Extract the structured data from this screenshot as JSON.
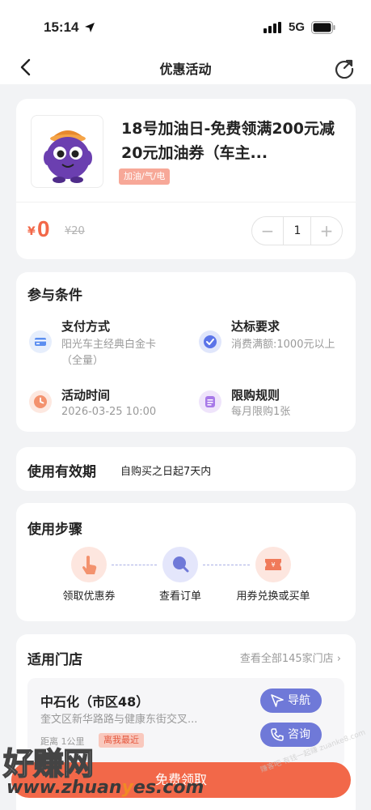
{
  "status_bar": {
    "time": "15:14",
    "network": "5G"
  },
  "nav": {
    "title": "优惠活动"
  },
  "product": {
    "title": "18号加油日-免费领满200元减20元加油券（车主...",
    "tag": "加油/气/电",
    "currency": "¥",
    "price": "0",
    "original_price": "¥20",
    "quantity": "1",
    "minus": "−",
    "plus": "+"
  },
  "conditions": {
    "title": "参与条件",
    "payment": {
      "label": "支付方式",
      "value": "阳光车主经典白金卡（全量）"
    },
    "standard": {
      "label": "达标要求",
      "value": "消费满额:1000元以上"
    },
    "time": {
      "label": "活动时间",
      "value": "2026-03-25 10:00"
    },
    "limit": {
      "label": "限购规则",
      "value": "每月限购1张"
    }
  },
  "validity": {
    "label": "使用有效期",
    "value": "自购买之日起7天内"
  },
  "steps": {
    "title": "使用步骤",
    "items": [
      {
        "label": "领取优惠券"
      },
      {
        "label": "查看订单"
      },
      {
        "label": "用券兑换或买单"
      }
    ]
  },
  "stores": {
    "title": "适用门店",
    "view_all": "查看全部145家门店 ›",
    "store": {
      "name": "中石化（市区48）",
      "address": "奎文区新华路路与健康东街交叉...",
      "distance": "距离 1公里",
      "badge": "离我最近",
      "nav_label": "导航",
      "consult_label": "咨询"
    }
  },
  "bottom_button": {
    "label": "免费领取"
  },
  "watermark": {
    "text": "好赚网",
    "url_pre": "www.zhuan",
    "url_y": "y",
    "url_post": "es.com",
    "small": "赚客吧 有钱一起赚 zuanke8.com"
  },
  "colors": {
    "accent": "#f26849",
    "blue": "#6f79d8",
    "tag": "#f7a898"
  }
}
